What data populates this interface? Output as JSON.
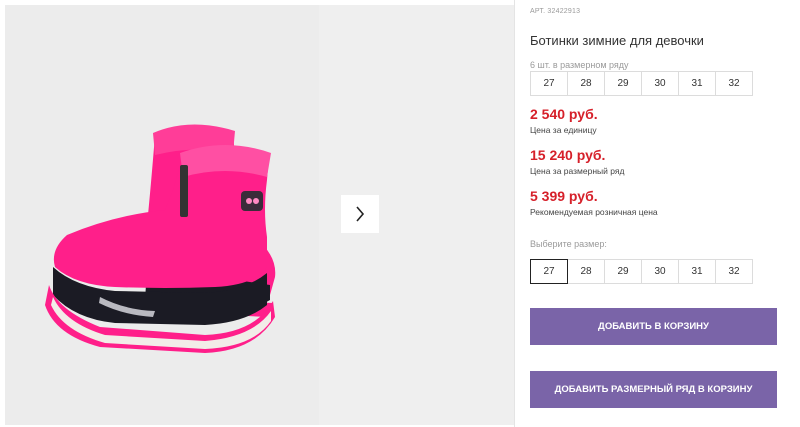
{
  "product": {
    "article": "АРТ. 32422913",
    "title": "Ботинки зимние для девочки",
    "image_alt": "pink winter boots"
  },
  "pack": {
    "label": "6 шт. в размерном ряду",
    "sizes": [
      "27",
      "28",
      "29",
      "30",
      "31",
      "32"
    ]
  },
  "prices": {
    "unit_price": "2 540 руб.",
    "unit_label": "Цена за единицу",
    "pack_price": "15 240 руб.",
    "pack_label": "Цена за размерный ряд",
    "retail_price": "5 399 руб.",
    "retail_label": "Рекомендуемая розничная цена"
  },
  "size_select": {
    "label": "Выберите размер:",
    "sizes": [
      "27",
      "28",
      "29",
      "30",
      "31",
      "32"
    ],
    "selected": "27"
  },
  "buttons": {
    "add_to_cart": "Добавить в корзину",
    "add_pack_to_cart": "Добавить размерный ряд в корзину"
  },
  "gallery": {
    "next_icon": "chevron-right-icon"
  },
  "colors": {
    "accent": "#7a64a8",
    "price": "#d6202a",
    "boot_pink": "#ff2b8a"
  }
}
